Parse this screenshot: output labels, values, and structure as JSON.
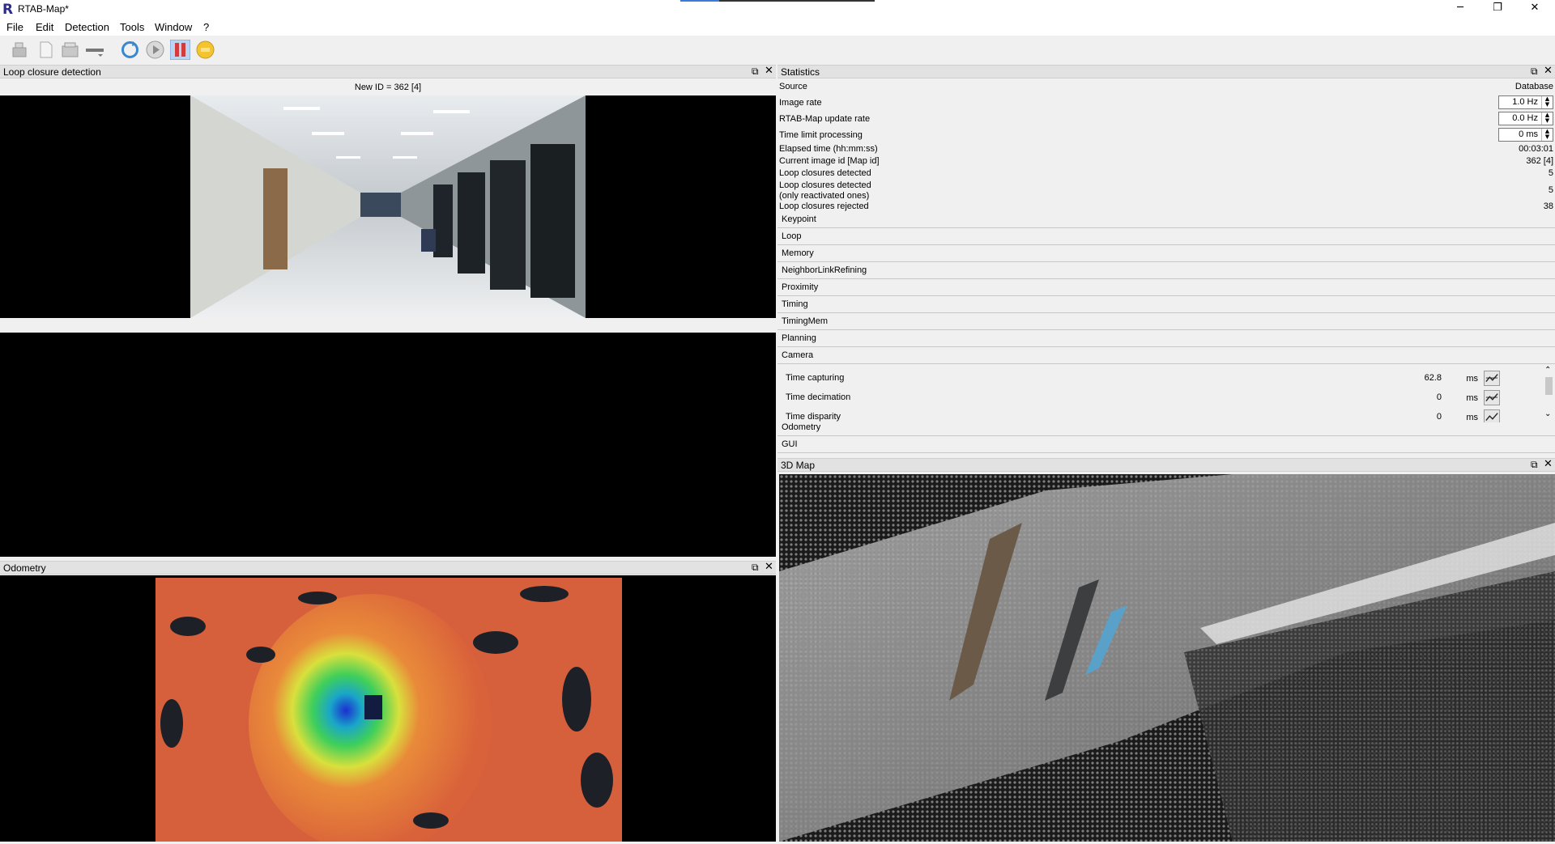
{
  "window": {
    "title": "RTAB-Map*",
    "app_icon": "R",
    "controls": {
      "minimize": "─",
      "restore": "❐",
      "close": "✕"
    }
  },
  "menu": [
    "File",
    "Edit",
    "Detection",
    "Tools",
    "Window",
    "?"
  ],
  "toolbar": {
    "icons": [
      "open-database-icon",
      "new-database-icon",
      "close-database-icon",
      "edit-database-icon",
      "trigger-new-map-icon",
      "play-icon",
      "pause-icon",
      "stop-icon"
    ]
  },
  "docks": {
    "loop_closure": {
      "title": "Loop closure detection",
      "image_label": "New ID = 362 [4]"
    },
    "odometry": {
      "title": "Odometry"
    },
    "statistics": {
      "title": "Statistics"
    },
    "map3d": {
      "title": "3D Map"
    },
    "float_icon": "⧉",
    "close_icon": "✕"
  },
  "statistics": {
    "source": {
      "label": "Source",
      "value": "Database"
    },
    "image_rate": {
      "label": "Image rate",
      "value": "1.0 Hz"
    },
    "update_rate": {
      "label": "RTAB-Map update rate",
      "value": "0.0 Hz"
    },
    "time_limit": {
      "label": "Time limit processing",
      "value": "0 ms"
    },
    "elapsed": {
      "label": "Elapsed time (hh:mm:ss)",
      "value": "00:03:01"
    },
    "current_id": {
      "label": "Current image id [Map id]",
      "value": "362 [4]"
    },
    "loops_detected": {
      "label": "Loop closures detected",
      "value": "5"
    },
    "loops_reactivated": {
      "label_line1": "Loop closures detected",
      "label_line2": "(only reactivated ones)",
      "value": "5"
    },
    "loops_rejected": {
      "label": "Loop closures rejected",
      "value": "38"
    },
    "sections": [
      "Keypoint",
      "Loop",
      "Memory",
      "NeighborLinkRefining",
      "Proximity",
      "Timing",
      "TimingMem",
      "Planning",
      "Camera"
    ],
    "sections_after": [
      "Odometry",
      "GUI"
    ],
    "camera_items": [
      {
        "name": "Time capturing",
        "value": "62.8",
        "unit": "ms"
      },
      {
        "name": "Time decimation",
        "value": "0",
        "unit": "ms"
      },
      {
        "name": "Time disparity",
        "value": "0",
        "unit": "ms"
      }
    ],
    "spin_up": "▲",
    "spin_down": "▼",
    "scroll_up": "⌃",
    "scroll_down": "⌄"
  },
  "colors": {
    "dock_title_bg": "#e2e2e2",
    "accent_pause": "#d43b3b",
    "accent_stop": "#f4c430"
  }
}
